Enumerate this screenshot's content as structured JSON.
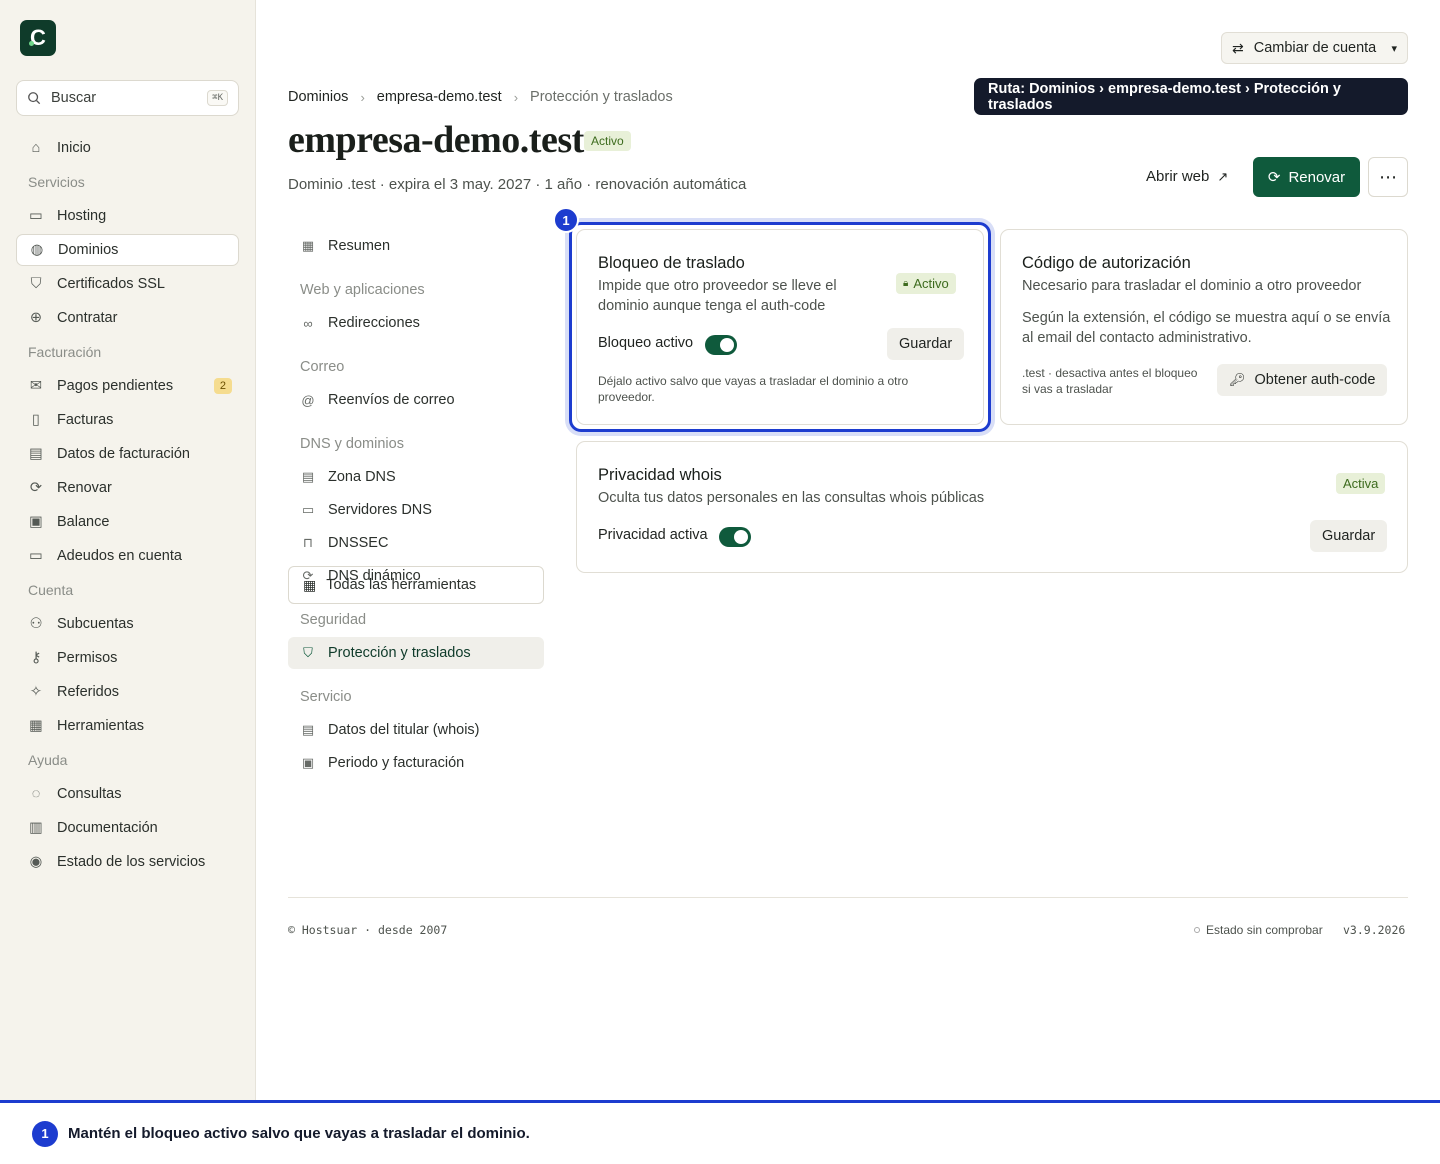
{
  "app": {
    "logo_letter": "C",
    "search": {
      "placeholder": "Buscar",
      "shortcut": "⌘K"
    },
    "account_switch": "Cambiar de cuenta"
  },
  "sidebar": {
    "items": [
      {
        "type": "item",
        "label": "Inicio",
        "icon": "home-icon"
      },
      {
        "type": "section",
        "label": "Servicios"
      },
      {
        "type": "item",
        "label": "Hosting",
        "icon": "server-icon"
      },
      {
        "type": "item",
        "label": "Dominios",
        "icon": "globe-icon",
        "active": true
      },
      {
        "type": "item",
        "label": "Certificados SSL",
        "icon": "shield-icon"
      },
      {
        "type": "item",
        "label": "Contratar",
        "icon": "plus-circle-icon"
      },
      {
        "type": "section",
        "label": "Facturación"
      },
      {
        "type": "item",
        "label": "Pagos pendientes",
        "icon": "mail-icon",
        "count": "2"
      },
      {
        "type": "item",
        "label": "Facturas",
        "icon": "file-icon"
      },
      {
        "type": "item",
        "label": "Datos de facturación",
        "icon": "id-card-icon"
      },
      {
        "type": "item",
        "label": "Renovar",
        "icon": "refresh-icon"
      },
      {
        "type": "item",
        "label": "Balance",
        "icon": "banknote-icon"
      },
      {
        "type": "item",
        "label": "Adeudos en cuenta",
        "icon": "credit-card-icon"
      },
      {
        "type": "section",
        "label": "Cuenta"
      },
      {
        "type": "item",
        "label": "Subcuentas",
        "icon": "users-icon"
      },
      {
        "type": "item",
        "label": "Permisos",
        "icon": "key-icon"
      },
      {
        "type": "item",
        "label": "Referidos",
        "icon": "sparkles-icon"
      },
      {
        "type": "item",
        "label": "Herramientas",
        "icon": "grid-icon"
      },
      {
        "type": "section",
        "label": "Ayuda"
      },
      {
        "type": "item",
        "label": "Consultas",
        "icon": "chat-icon"
      },
      {
        "type": "item",
        "label": "Documentación",
        "icon": "book-icon"
      },
      {
        "type": "item",
        "label": "Estado de los servicios",
        "icon": "broadcast-icon"
      }
    ]
  },
  "tooltip": "Ruta: Dominios › empresa-demo.test › Protección y traslados",
  "breadcrumb": [
    "Dominios",
    "empresa-demo.test",
    "Protección y traslados"
  ],
  "header": {
    "title": "empresa-demo.test",
    "status": "Activo",
    "subtitle": "Dominio .test · expira el 3 may. 2027 · 1 año · renovación automática",
    "open_web": "Abrir web",
    "renew": "Renovar"
  },
  "subnav": {
    "items": [
      {
        "type": "item",
        "label": "Resumen",
        "icon": "grid-icon"
      },
      {
        "type": "section",
        "label": "Web y aplicaciones"
      },
      {
        "type": "item",
        "label": "Redirecciones",
        "icon": "link-icon"
      },
      {
        "type": "section",
        "label": "Correo"
      },
      {
        "type": "item",
        "label": "Reenvíos de correo",
        "icon": "at-icon"
      },
      {
        "type": "section",
        "label": "DNS y dominios"
      },
      {
        "type": "item",
        "label": "Zona DNS",
        "icon": "table-icon"
      },
      {
        "type": "item",
        "label": "Servidores DNS",
        "icon": "server-icon"
      },
      {
        "type": "item",
        "label": "DNSSEC",
        "icon": "lock-icon"
      },
      {
        "type": "item",
        "label": "DNS dinámico",
        "icon": "refresh-icon"
      },
      {
        "type": "section",
        "label": "Seguridad"
      },
      {
        "type": "item",
        "label": "Protección y traslados",
        "icon": "shield-icon",
        "active": true
      },
      {
        "type": "section",
        "label": "Servicio"
      },
      {
        "type": "item",
        "label": "Datos del titular (whois)",
        "icon": "id-card-icon"
      },
      {
        "type": "item",
        "label": "Periodo y facturación",
        "icon": "banknote-icon"
      }
    ],
    "all_tools": "Todas las herramientas"
  },
  "transfer_lock": {
    "title": "Bloqueo de traslado",
    "desc": "Impide que otro proveedor se lleve el dominio aunque tenga el auth-code",
    "status": "Activo",
    "toggle_label": "Bloqueo activo",
    "toggle_on": true,
    "save": "Guardar",
    "hint": "Déjalo activo salvo que vayas a trasladar el dominio a otro proveedor."
  },
  "auth_code": {
    "title": "Código de autorización",
    "desc": "Necesario para trasladar el dominio a otro proveedor",
    "body": "Según la extensión, el código se muestra aquí o se envía al email del contacto administrativo.",
    "note": ".test · desactiva antes el bloqueo si vas a trasladar",
    "button": "Obtener auth-code"
  },
  "whois_privacy": {
    "title": "Privacidad whois",
    "desc": "Oculta tus datos personales en las consultas whois públicas",
    "status": "Activa",
    "toggle_label": "Privacidad activa",
    "toggle_on": true,
    "save": "Guardar"
  },
  "footer": {
    "left": "© Hostsuar · desde 2007",
    "status": "Estado sin comprobar",
    "version": "v3.9.2026"
  },
  "callout": {
    "step": "1",
    "text": "Mantén el bloqueo activo salvo que vayas a trasladar el dominio."
  },
  "colors": {
    "brand": "#0f5a3c",
    "highlight": "#1d3ccf",
    "tooltip_bg": "#141a2b"
  }
}
